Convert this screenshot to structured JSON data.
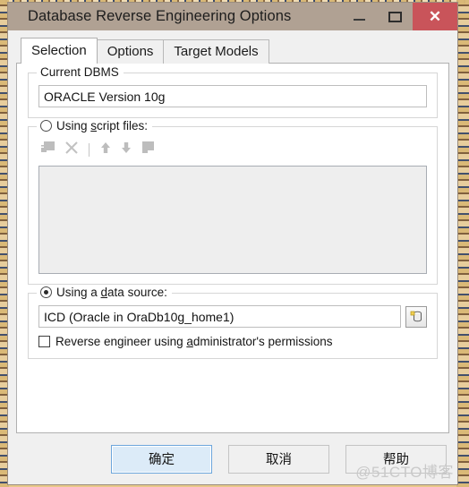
{
  "window": {
    "title": "Database Reverse Engineering Options",
    "controls": {
      "minimize": "—",
      "maximize": "",
      "close": "✕"
    }
  },
  "tabs": [
    {
      "label": "Selection",
      "active": true
    },
    {
      "label": "Options",
      "active": false
    },
    {
      "label": "Target Models",
      "active": false
    }
  ],
  "selection_tab": {
    "current_dbms": {
      "legend": "Current DBMS",
      "value": "ORACLE Version 10g"
    },
    "script_files": {
      "legend_pre": "Using ",
      "legend_acc": "s",
      "legend_post": "cript files:",
      "selected": false,
      "toolbar": [
        "add-script-icon",
        "remove-script-icon",
        "separator",
        "move-up-icon",
        "move-down-icon",
        "edit-script-icon"
      ],
      "list_items": []
    },
    "data_source": {
      "legend_pre": "Using a ",
      "legend_acc": "d",
      "legend_post": "ata source:",
      "selected": true,
      "value": "ICD (Oracle in OraDb10g_home1)",
      "browse_icon": "database-icon",
      "admin_checkbox": {
        "checked": false,
        "label_pre": "Reverse engineer using ",
        "label_acc": "a",
        "label_post": "dministrator's permissions"
      }
    }
  },
  "footer": {
    "ok_label": "确定",
    "cancel_label": "取消",
    "help_label": "帮助"
  },
  "watermark": "@51CTO博客",
  "colors": {
    "titlebar": "#b0a193",
    "close_button": "#c9545a",
    "dialog_bg": "#f0f0f0",
    "tabpage_bg": "#ffffff",
    "default_button_bg": "#dcebf8",
    "default_button_border": "#6ca6dc",
    "backdrop": "#e8c98a"
  }
}
